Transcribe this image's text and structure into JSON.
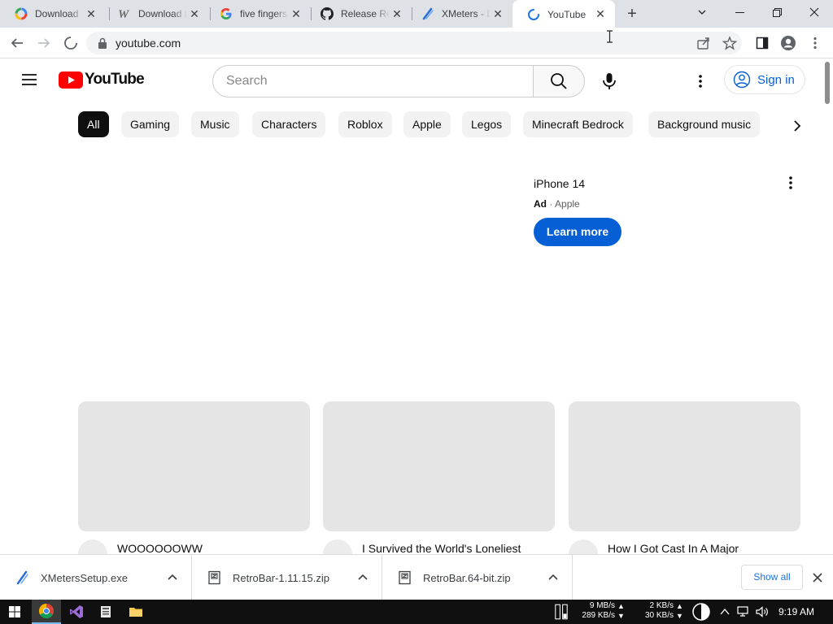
{
  "browser": {
    "tabs": [
      {
        "title": "Download",
        "favicon": "colorful-circle-icon",
        "active": false
      },
      {
        "title": "Download t",
        "favicon": "w-logo-icon",
        "active": false
      },
      {
        "title": "five fingers",
        "favicon": "google-g-icon",
        "active": false
      },
      {
        "title": "Release Ret",
        "favicon": "github-icon",
        "active": false
      },
      {
        "title": "XMeters - D",
        "favicon": "xmeters-icon",
        "active": false
      },
      {
        "title": "YouTube",
        "favicon": "loading-spinner-icon",
        "active": true
      }
    ],
    "url": "youtube.com"
  },
  "youtube": {
    "logo_text": "YouTube",
    "search_placeholder": "Search",
    "signin_label": "Sign in",
    "chips": [
      "All",
      "Gaming",
      "Music",
      "Characters",
      "Roblox",
      "Apple",
      "Legos",
      "Minecraft Bedrock",
      "Background music"
    ],
    "ad": {
      "title": "iPhone 14",
      "ad_label": "Ad",
      "separator": "·",
      "advertiser": "Apple",
      "cta": "Learn more"
    },
    "videos": [
      {
        "title": "WOOOOOOWW"
      },
      {
        "title": "I Survived the World's Loneliest"
      },
      {
        "title": "How I Got Cast In A Major"
      }
    ]
  },
  "downloads": {
    "items": [
      {
        "name": "XMetersSetup.exe",
        "icon": "xmeters-icon"
      },
      {
        "name": "RetroBar-1.11.15.zip",
        "icon": "zip-archive-icon"
      },
      {
        "name": "RetroBar.64-bit.zip",
        "icon": "zip-archive-icon"
      }
    ],
    "show_all": "Show all"
  },
  "taskbar": {
    "net_disk_top": "9 MB/s",
    "net_disk_bottom": "289 KB/s",
    "net_top": "2 KB/s",
    "net_bottom": "30 KB/s",
    "time": "9:19 AM"
  }
}
